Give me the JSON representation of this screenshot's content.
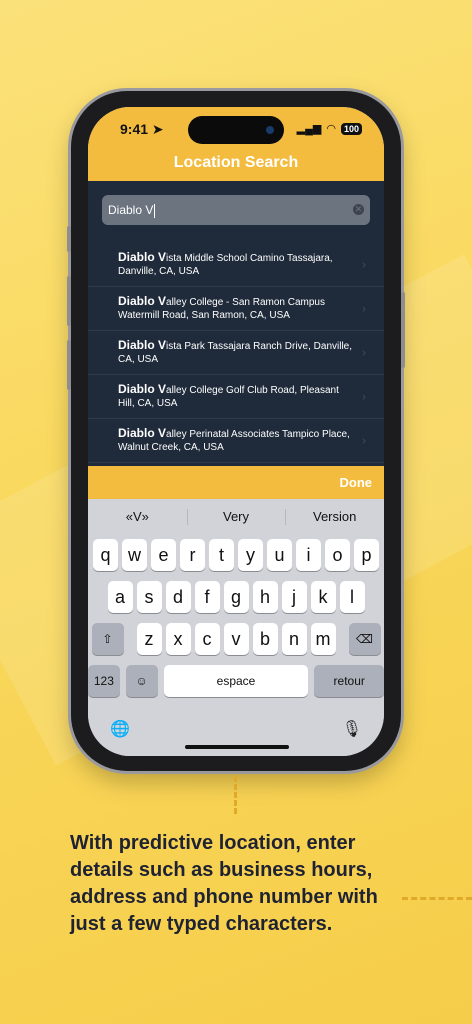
{
  "status": {
    "time": "9:41",
    "battery": "100"
  },
  "header": {
    "title": "Location Search"
  },
  "search": {
    "value": "Diablo V"
  },
  "results": [
    {
      "match": "Diablo V",
      "rest": "ista Middle School Camino Tassajara, Danville, CA, USA"
    },
    {
      "match": "Diablo V",
      "rest": "alley College - San Ramon Campus Watermill Road, San Ramon, CA, USA"
    },
    {
      "match": "Diablo V",
      "rest": "ista Park Tassajara Ranch Drive, Danville, CA, USA"
    },
    {
      "match": "Diablo V",
      "rest": "alley College Golf Club Road, Pleasant Hill, CA, USA"
    },
    {
      "match": "Diablo V",
      "rest": "alley Perinatal Associates Tampico Place, Walnut Creek, CA, USA"
    }
  ],
  "toolbar": {
    "done_label": "Done"
  },
  "keyboard": {
    "predictions": [
      "«V»",
      "Very",
      "Version"
    ],
    "row1": [
      "q",
      "w",
      "e",
      "r",
      "t",
      "y",
      "u",
      "i",
      "o",
      "p"
    ],
    "row2": [
      "a",
      "s",
      "d",
      "f",
      "g",
      "h",
      "j",
      "k",
      "l"
    ],
    "row3": [
      "z",
      "x",
      "c",
      "v",
      "b",
      "n",
      "m"
    ],
    "numbers_label": "123",
    "space_label": "espace",
    "return_label": "retour"
  },
  "caption": "With predictive location, enter details such as business hours, address and phone number with just a few typed characters.",
  "colors": {
    "accent": "#f4bc3f",
    "dark_panel": "#1f2a3a"
  }
}
